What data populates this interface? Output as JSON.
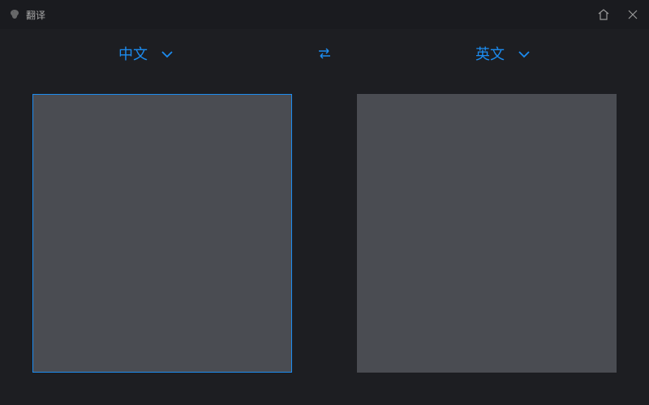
{
  "titlebar": {
    "title": "翻译"
  },
  "languages": {
    "source": "中文",
    "target": "英文"
  }
}
